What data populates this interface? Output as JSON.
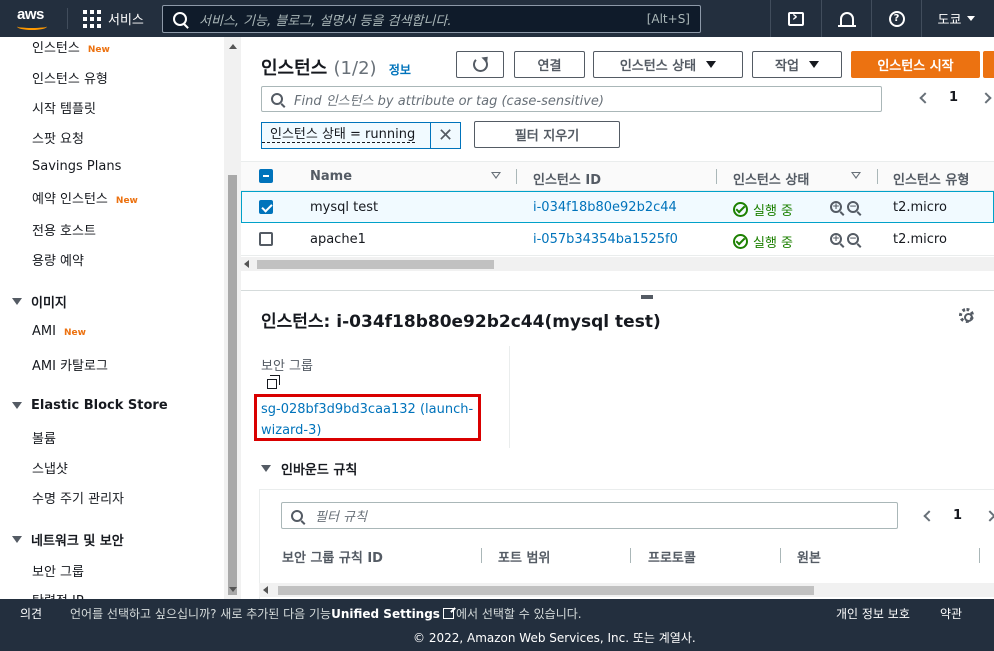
{
  "topnav": {
    "logo_text": "aws",
    "services_label": "서비스",
    "search_placeholder": "서비스, 기능, 블로그, 설명서 등을 검색합니다.",
    "search_shortcut": "[Alt+S]",
    "region_label": "도쿄"
  },
  "sidebar": {
    "new_badge": "New",
    "items": [
      {
        "label": "인스턴스",
        "new": true
      },
      {
        "label": "인스턴스 유형"
      },
      {
        "label": "시작 템플릿"
      },
      {
        "label": "스팟 요청"
      },
      {
        "label": "Savings Plans"
      },
      {
        "label": "예약 인스턴스",
        "new": true
      },
      {
        "label": "전용 호스트"
      },
      {
        "label": "용량 예약"
      }
    ],
    "images_header": "이미지",
    "image_items": [
      {
        "label": "AMI",
        "new": true
      },
      {
        "label": "AMI 카탈로그"
      }
    ],
    "ebs_header": "Elastic Block Store",
    "ebs_items": [
      {
        "label": "볼륨"
      },
      {
        "label": "스냅샷"
      },
      {
        "label": "수명 주기 관리자"
      }
    ],
    "network_header": "네트워크 및 보안",
    "network_items": [
      {
        "label": "보안 그룹"
      },
      {
        "label": "탄력적 IP"
      }
    ]
  },
  "main": {
    "title": "인스턴스",
    "count": "(1/2)",
    "info_link": "정보",
    "connect_button": "연결",
    "instance_state_button": "인스턴스 상태",
    "actions_button": "작업",
    "launch_button": "인스턴스 시작",
    "find_placeholder": "Find 인스턴스 by attribute or tag (case-sensitive)",
    "page_number": "1",
    "filter_token": "인스턴스 상태 = running",
    "clear_filters": "필터 지우기",
    "columns": [
      "Name",
      "인스턴스 ID",
      "인스턴스 상태",
      "인스턴스 유형"
    ],
    "rows": [
      {
        "name": "mysql test",
        "id": "i-034f18b80e92b2c44",
        "state": "실행 중",
        "type": "t2.micro",
        "selected": true
      },
      {
        "name": "apache1",
        "id": "i-057b34354ba1525f0",
        "state": "실행 중",
        "type": "t2.micro",
        "selected": false
      }
    ]
  },
  "detail": {
    "title": "인스턴스: i-034f18b80e92b2c44(mysql test)",
    "sg_label": "보안 그룹",
    "sg_link": "sg-028bf3d9bd3caa132 (launch-wizard-3)",
    "inbound_header": "인바운드 규칙",
    "filter_rules_placeholder": "필터 규칙",
    "rules_page": "1",
    "rule_columns": [
      "보안 그룹 규칙 ID",
      "포트 범위",
      "프로토콜",
      "원본"
    ]
  },
  "footer": {
    "feedback": "의견",
    "lang_text": "언어를 선택하고 싶으십니까? 새로 추가된 다음 기능",
    "unified_settings": "Unified Settings",
    "lang_text2": "에서 선택할 수 있습니다.",
    "privacy": "개인 정보 보호",
    "terms": "약관",
    "copyright": "© 2022, Amazon Web Services, Inc. 또는 계열사."
  },
  "colors": {
    "nav_bg": "#232f3e",
    "accent": "#ec7211",
    "link": "#0073bb",
    "success": "#1d8102",
    "highlight_box": "#d90000"
  }
}
